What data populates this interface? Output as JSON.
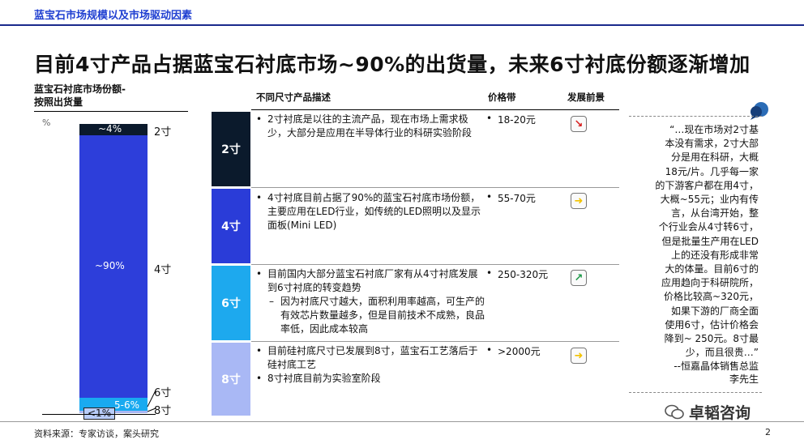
{
  "header": {
    "section_label": "蓝宝石市场规模以及市场驱动因素",
    "headline": "目前4寸产品占据蓝宝石衬底市场~90%的出货量，未来6寸衬底份额逐渐增加"
  },
  "chart": {
    "title_line1": "蓝宝石衬底市场份额-",
    "title_line2": "按照出货量",
    "unit": "%"
  },
  "chart_data": {
    "type": "bar",
    "stacked": true,
    "title": "蓝宝石衬底市场份额-按照出货量",
    "ylabel": "%",
    "categories": [
      "蓝宝石衬底市场份额"
    ],
    "series": [
      {
        "name": "2寸",
        "values": [
          4
        ],
        "label": "~4%",
        "color": "#0b1a2c"
      },
      {
        "name": "4寸",
        "values": [
          90
        ],
        "label": "~90%",
        "color": "#2d3eda"
      },
      {
        "name": "6寸",
        "values": [
          5.5
        ],
        "label": "5-6%",
        "color": "#19aaf0"
      },
      {
        "name": "8寸",
        "values": [
          0.5
        ],
        "label": "<1%",
        "color": "#a9b7f4"
      }
    ]
  },
  "table": {
    "headers": {
      "description": "不同尺寸产品描述",
      "price": "价格带",
      "outlook": "发展前景"
    },
    "rows": [
      {
        "size": "2寸",
        "block_color": "#0b1a2c",
        "bullets": [
          "2寸衬底是以往的主流产品，现在市场上需求极少，大部分是应用在半导体行业的科研实验阶段"
        ],
        "dashes": [],
        "price": "18-20元",
        "outlook": "down",
        "outlook_icon": "arrow-down-red-icon",
        "outlook_color": "#d81e1e"
      },
      {
        "size": "4寸",
        "block_color": "#2a3cd8",
        "bullets": [
          "4寸衬底目前占据了90%的蓝宝石衬底市场份额，主要应用在LED行业，如传统的LED照明以及显示面板(Mini LED)"
        ],
        "dashes": [],
        "price": "55-70元",
        "outlook": "flat",
        "outlook_icon": "arrow-right-yellow-icon",
        "outlook_color": "#f2c200"
      },
      {
        "size": "6寸",
        "block_color": "#1da9ee",
        "bullets": [
          "目前国内大部分蓝宝石衬底厂家有从4寸衬底发展到6寸衬底的转变趋势"
        ],
        "dashes": [
          "因为衬底尺寸越大，面积利用率越高，可生产的有效芯片数量越多，但是目前技术不成熟，良品率低，因此成本较高"
        ],
        "price": "250-320元",
        "outlook": "up",
        "outlook_icon": "arrow-up-green-icon",
        "outlook_color": "#1f9a4a"
      },
      {
        "size": "8寸",
        "block_color": "#a9b8f5",
        "bullets": [
          "目前硅衬底尺寸已发展到8寸，蓝宝石工艺落后于硅衬底工艺",
          "8寸衬底目前为实验室阶段"
        ],
        "dashes": [],
        "price": ">2000元",
        "outlook": "flat",
        "outlook_icon": "arrow-right-yellow-icon",
        "outlook_color": "#f2c200"
      }
    ]
  },
  "quote": {
    "lines": [
      "“…现在市场对2寸基",
      "本没有需求，2寸大部",
      "分是用在科研，大概",
      "18元/片。几乎每一家",
      "的下游客户都在用4寸，",
      "大概~55元；业内有传",
      "言，从台湾开始，整",
      "个行业会从4寸转6寸，",
      "但是批量生产用在LED",
      "上的还没有形成非常",
      "大的体量。目前6寸的",
      "应用趋向于科研院所，",
      "价格比较高~320元，",
      "如果下游的厂商全面",
      "使用6寸，估计价格会",
      "降到~ 250元。8寸最",
      "少，而且很贵…”"
    ],
    "author_line1": "--恒嘉晶体销售总监",
    "author_line2": "李先生"
  },
  "footer": {
    "source": "资料来源：专家访谈，案头研究",
    "page": "2",
    "watermark": "卓韬咨询"
  }
}
